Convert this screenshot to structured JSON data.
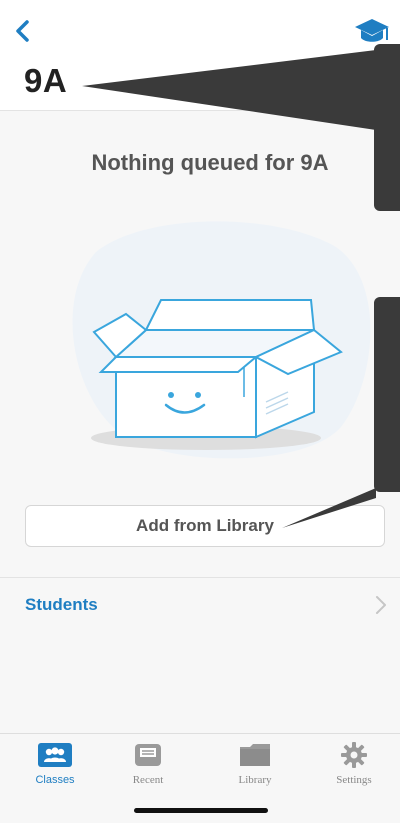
{
  "header": {
    "title": "9A",
    "back_icon": "chevron-left-icon",
    "right_icon": "graduation-cap-icon"
  },
  "empty_state": {
    "message": "Nothing queued for 9A",
    "illustration": "smiling-open-box"
  },
  "actions": {
    "add_from_library": "Add from Library"
  },
  "sections": {
    "students_label": "Students"
  },
  "tabbar": {
    "tabs": [
      {
        "label": "Classes",
        "icon": "people-icon",
        "active": true
      },
      {
        "label": "Recent",
        "icon": "tray-icon",
        "active": false
      },
      {
        "label": "Library",
        "icon": "folder-icon",
        "active": false
      },
      {
        "label": "Settings",
        "icon": "gear-icon",
        "active": false
      }
    ]
  },
  "colors": {
    "accent": "#1f7ec2",
    "box_stroke": "#3aa6dd",
    "callout": "#3a3a3a"
  }
}
